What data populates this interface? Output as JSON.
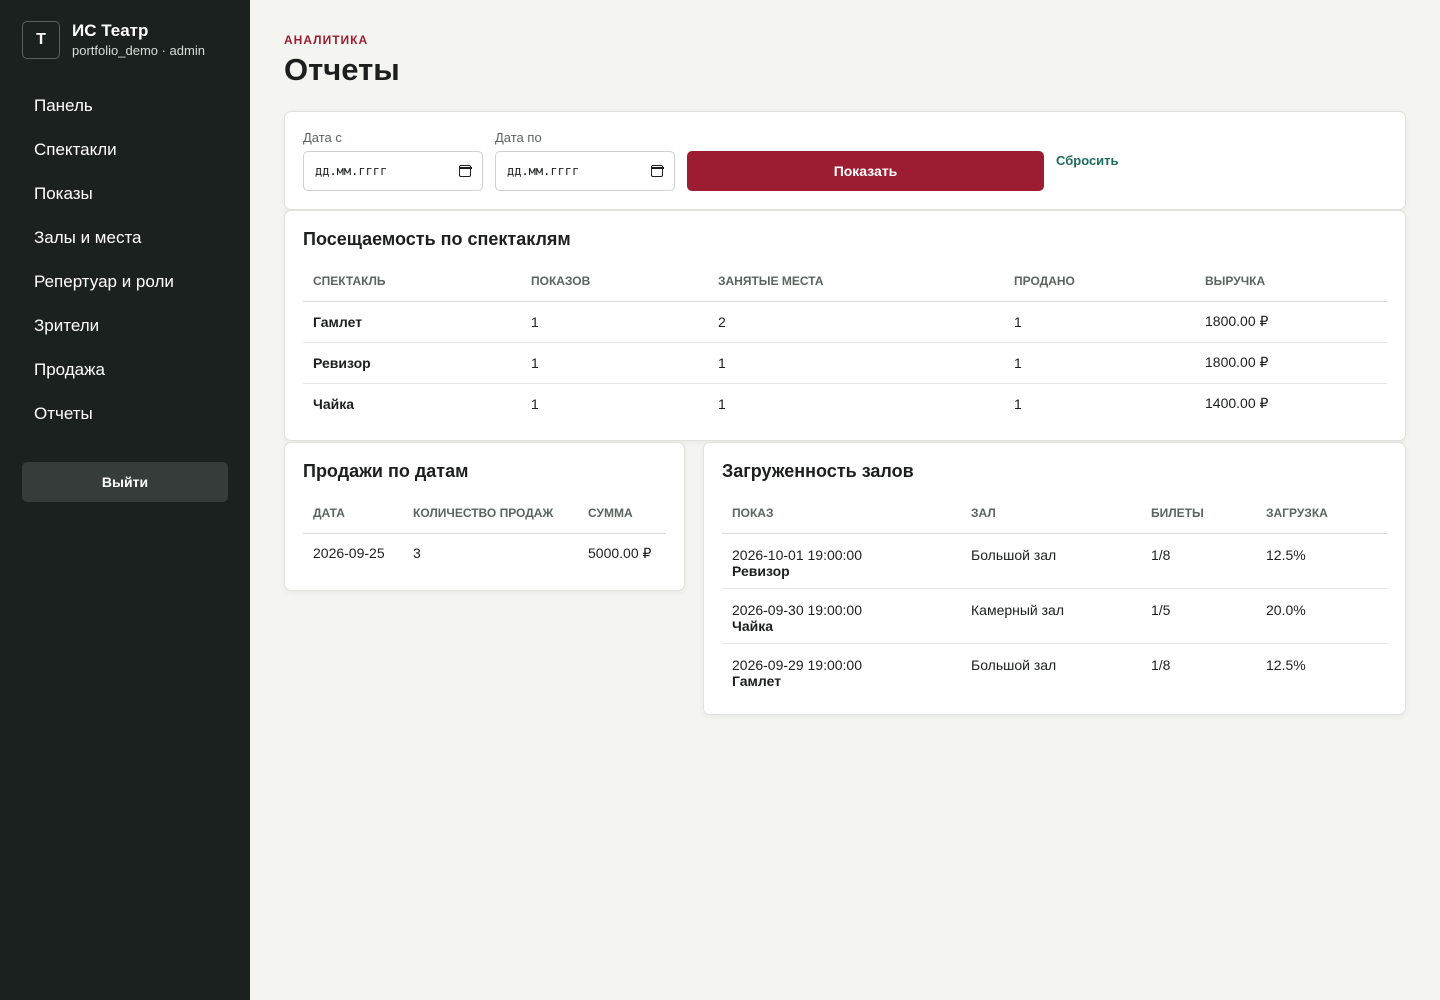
{
  "brand": {
    "logo": "Т",
    "title": "ИС Театр",
    "subtitle": "portfolio_demo · admin"
  },
  "nav": [
    "Панель",
    "Спектакли",
    "Показы",
    "Залы и места",
    "Репертуар и роли",
    "Зрители",
    "Продажа",
    "Отчеты"
  ],
  "logout_label": "Выйти",
  "header": {
    "eyebrow": "АНАЛИТИКА",
    "title": "Отчеты"
  },
  "filter": {
    "date_from_label": "Дата с",
    "date_from_value": "дд.мм.гггг",
    "date_to_label": "Дата по",
    "date_to_value": "дд.мм.гггг",
    "show_label": "Показать",
    "reset_label": "Сбросить"
  },
  "attendance": {
    "title": "Посещаемость по спектаклям",
    "columns": [
      "Спектакль",
      "Показов",
      "Занятые места",
      "Продано",
      "Выручка"
    ],
    "rows": [
      [
        "Гамлет",
        "1",
        "2",
        "1",
        "1800.00 ₽"
      ],
      [
        "Ревизор",
        "1",
        "1",
        "1",
        "1800.00 ₽"
      ],
      [
        "Чайка",
        "1",
        "1",
        "1",
        "1400.00 ₽"
      ]
    ]
  },
  "sales": {
    "title": "Продажи по датам",
    "columns": [
      "Дата",
      "Количество продаж",
      "Сумма"
    ],
    "rows": [
      [
        "2026-09-25",
        "3",
        "5000.00 ₽"
      ]
    ]
  },
  "load": {
    "title": "Загруженность залов",
    "columns": [
      "Показ",
      "Зал",
      "Билеты",
      "Загрузка"
    ],
    "rows": [
      [
        "2026-10-01 19:00:00",
        "Ревизор",
        "Большой зал",
        "1/8",
        "12.5%"
      ],
      [
        "2026-09-30 19:00:00",
        "Чайка",
        "Камерный зал",
        "1/5",
        "20.0%"
      ],
      [
        "2026-09-29 19:00:00",
        "Гамлет",
        "Большой зал",
        "1/8",
        "12.5%"
      ]
    ]
  },
  "colors": {
    "accent": "#9c1c31",
    "sidebar": "#1a211e",
    "link": "#1f6b5c",
    "background": "#f4f5f1"
  }
}
